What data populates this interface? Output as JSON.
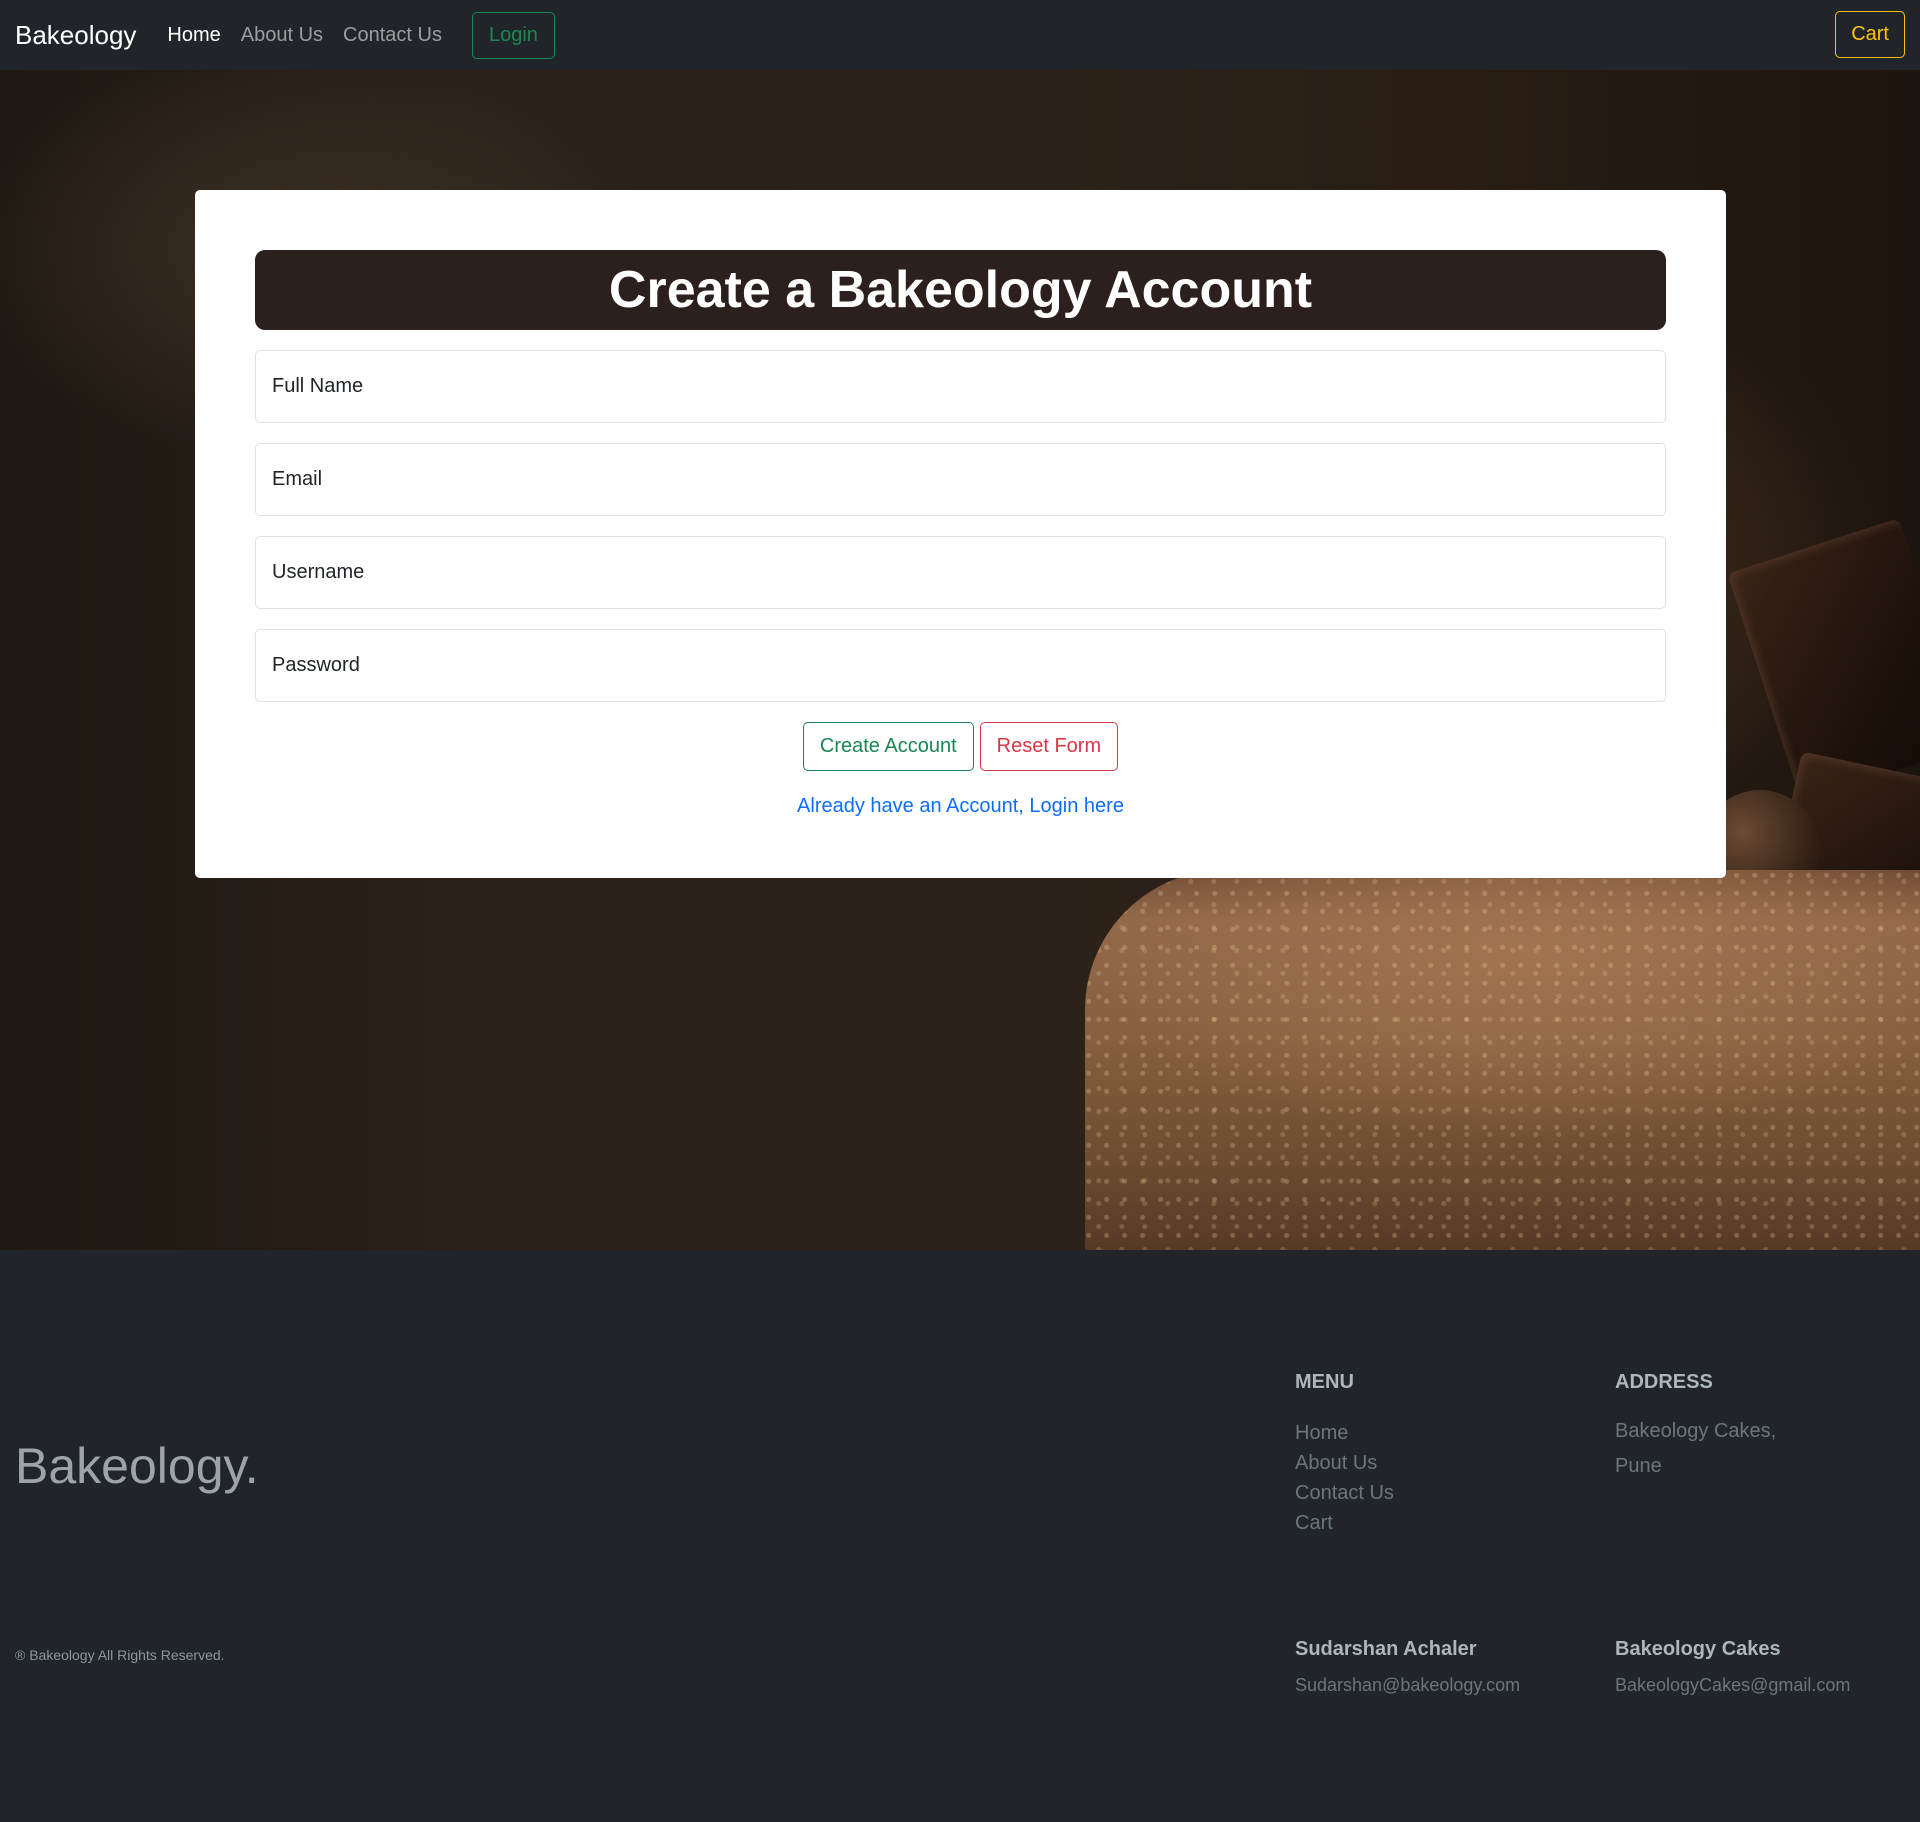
{
  "navbar": {
    "brand": "Bakeology",
    "links": [
      "Home",
      "About Us",
      "Contact Us"
    ],
    "login_label": "Login",
    "cart_label": "Cart"
  },
  "form": {
    "title": "Create a Bakeology Account",
    "fields": [
      "Full Name",
      "Email",
      "Username",
      "Password"
    ],
    "create_label": "Create Account",
    "reset_label": "Reset Form",
    "login_link": "Already have an Account, Login here"
  },
  "footer": {
    "brand": "Bakeology.",
    "copyright": "® Bakeology All Rights Reserved.",
    "menu": {
      "heading": "MENU",
      "items": [
        "Home",
        "About Us",
        "Contact Us",
        "Cart"
      ]
    },
    "address": {
      "heading": "ADDRESS",
      "lines": [
        "Bakeology Cakes,",
        "Pune"
      ]
    },
    "contacts": [
      {
        "name": "Sudarshan Achaler",
        "email": "Sudarshan@bakeology.com"
      },
      {
        "name": "Bakeology Cakes",
        "email": "BakeologyCakes@gmail.com"
      }
    ]
  },
  "colors": {
    "navbar_bg": "#212529",
    "success": "#198754",
    "danger": "#dc3545",
    "warning": "#ffc107",
    "link": "#0d6efd",
    "title_bg": "#2b201d"
  }
}
